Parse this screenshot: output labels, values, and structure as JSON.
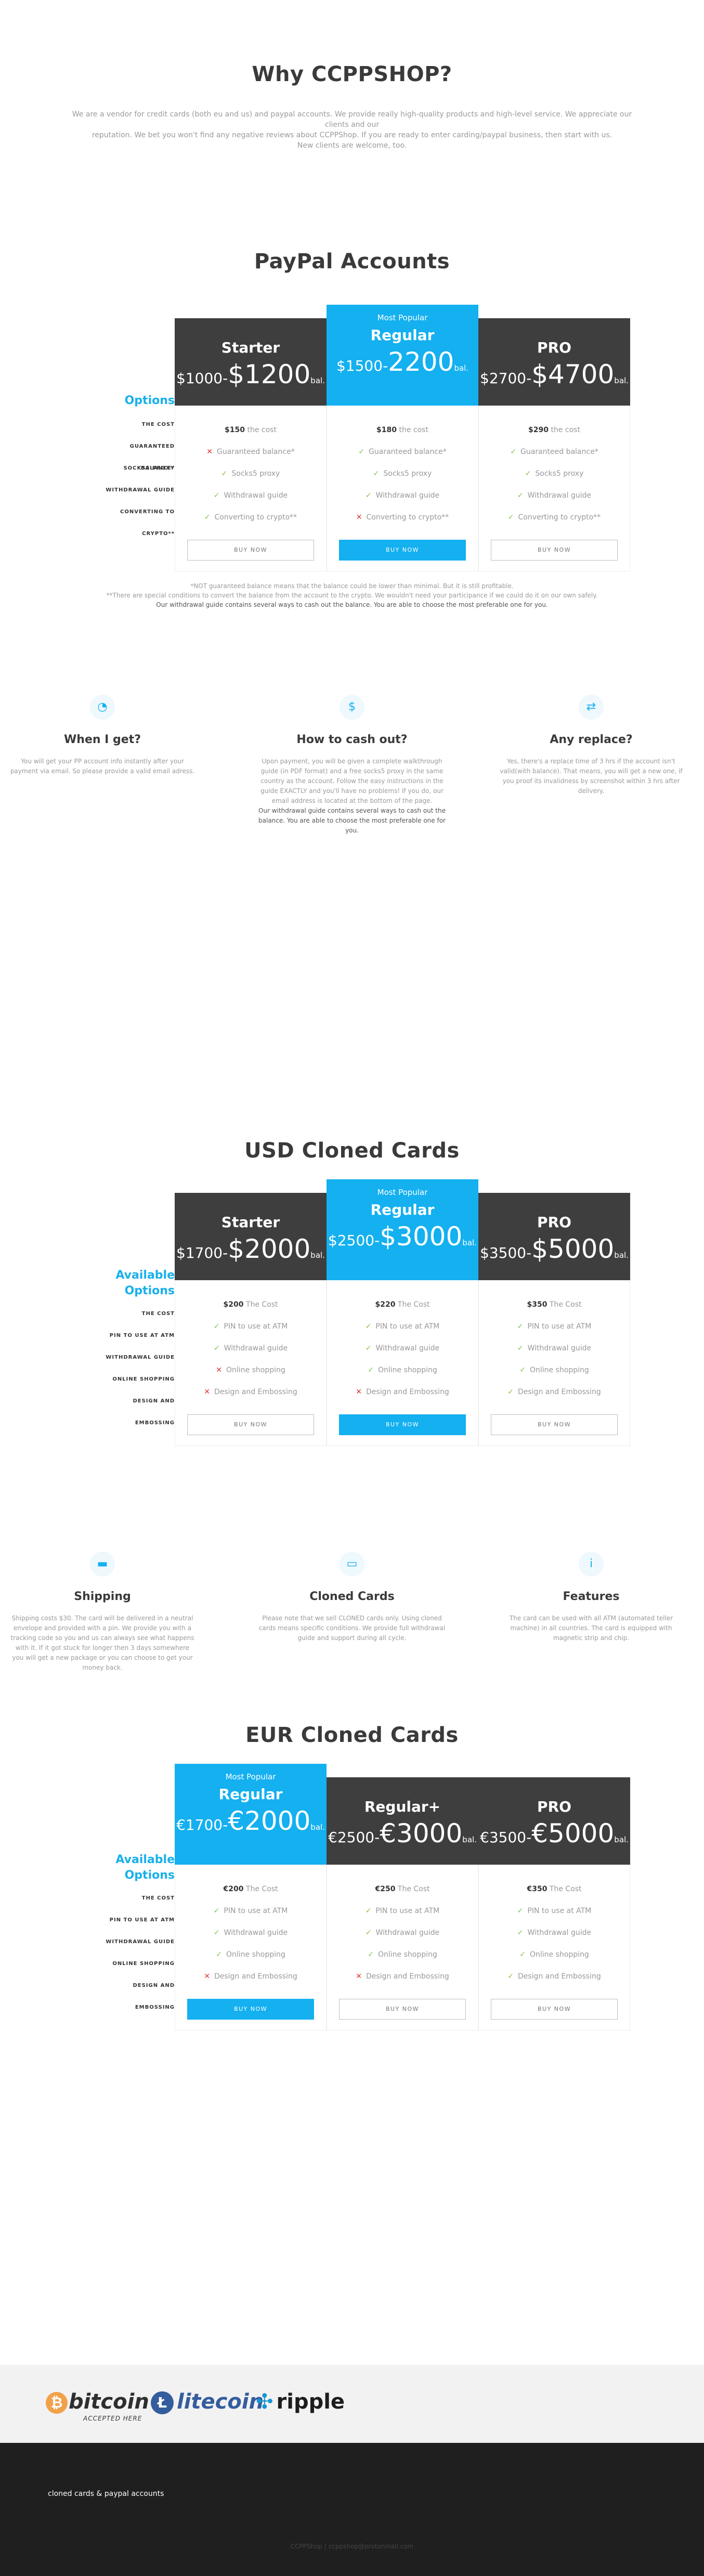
{
  "why": {
    "title": "Why CCPPSHOP?",
    "line1": "We are a vendor for credit cards (both eu and us) and paypal accounts. We provide really high-quality products and high-level service. We appreciate our clients and our",
    "line2": "reputation. We bet you won't find any negative reviews about CCPPShop. If you are ready to enter carding/paypal business, then start with us.",
    "line3": "New clients are welcome, too."
  },
  "paypal": {
    "title": "PayPal Accounts",
    "options_label": "Options",
    "row_labels": [
      "The cost",
      "Guaranteed balance*",
      "Socks5 proxy",
      "Withdrawal guide",
      "Converting to crypto**"
    ],
    "cols": [
      {
        "name": "Starter",
        "tag": "",
        "from": "$1000-",
        "to": "$1200",
        "ful": "bal.",
        "cost": "$150",
        "cost_label": "the cost",
        "features": [
          {
            "text": "Guaranteed balance*",
            "ok": false
          },
          {
            "text": "Socks5 proxy",
            "ok": true
          },
          {
            "text": "Withdrawal guide",
            "ok": true
          },
          {
            "text": "Converting to crypto**",
            "ok": true
          }
        ],
        "button": "Buy now"
      },
      {
        "name": "Regular",
        "tag": "Most Popular",
        "from": "$1500-",
        "to": "2200",
        "ful": "bal.",
        "cost": "$180",
        "cost_label": "the cost",
        "features": [
          {
            "text": "Guaranteed balance*",
            "ok": true
          },
          {
            "text": "Socks5 proxy",
            "ok": true
          },
          {
            "text": "Withdrawal guide",
            "ok": true
          },
          {
            "text": "Converting to crypto**",
            "ok": false
          }
        ],
        "button": "Buy now"
      },
      {
        "name": "PRO",
        "tag": "",
        "from": "$2700-",
        "to": "$4700",
        "ful": "bal.",
        "cost": "$290",
        "cost_label": "the cost",
        "features": [
          {
            "text": "Guaranteed balance*",
            "ok": true
          },
          {
            "text": "Socks5 proxy",
            "ok": true
          },
          {
            "text": "Withdrawal guide",
            "ok": true
          },
          {
            "text": "Converting to crypto**",
            "ok": true
          }
        ],
        "button": "Buy now"
      }
    ],
    "note1": "*NOT guaranteed balance means that the balance could be lower than minimal. But it is still profitable.",
    "note2": "**There are special conditions to convert the balance from the account to the crypto. We wouldn't need your participance if we could do it on our own safely.",
    "note3": "Our withdrawal guide contains several ways to cash out the balance. You are able to choose the most preferable one for you."
  },
  "info": [
    {
      "icon": "clock-icon",
      "glyph": "◔",
      "title": "When I get?",
      "text": "You will get your PP account info instantly after your payment via email. So please provide a valid email adress.",
      "strong": ""
    },
    {
      "icon": "dollar-icon",
      "glyph": "$",
      "title": "How to cash out?",
      "text": "Upon payment, you will be given a complete walkthrough guide (in PDF format) and a free socks5 proxy in the same country as the account. Follow the easy instructions in the guide EXACTLY and you'll have no problems! If you do, our email address is located at the bottom of the page.",
      "strong": "Our withdrawal guide contains several ways to cash out the balance. You are able to choose the most preferable one for you."
    },
    {
      "icon": "replace-icon",
      "glyph": "⇄",
      "title": "Any replace?",
      "text": "Yes, there's a replace time of 3 hrs if the account isn't valid(with balance). That means, you will get a new one, if you proof its invalidness by screenshot within 3 hrs after delivery.",
      "strong": ""
    }
  ],
  "usd": {
    "title": "USD Cloned Cards",
    "options_label": "Available Options",
    "row_labels": [
      "The cost",
      "PIN to use at ATM",
      "Withdrawal guide",
      "Online shopping",
      "Design and embossing"
    ],
    "cols": [
      {
        "name": "Starter",
        "tag": "",
        "from": "$1700-",
        "to": "$2000",
        "ful": "bal.",
        "cost": "$200",
        "cost_label": "The Cost",
        "features": [
          {
            "text": "PIN to use at ATM",
            "ok": true
          },
          {
            "text": "Withdrawal guide",
            "ok": true
          },
          {
            "text": "Online shopping",
            "ok": false
          },
          {
            "text": "Design and Embossing",
            "ok": false
          }
        ],
        "button": "Buy now"
      },
      {
        "name": "Regular",
        "tag": "Most Popular",
        "from": "$2500-",
        "to": "$3000",
        "ful": "bal.",
        "cost": "$220",
        "cost_label": "The Cost",
        "features": [
          {
            "text": "PIN to use at ATM",
            "ok": true
          },
          {
            "text": "Withdrawal guide",
            "ok": true
          },
          {
            "text": "Online shopping",
            "ok": true
          },
          {
            "text": "Design and Embossing",
            "ok": false
          }
        ],
        "button": "Buy now"
      },
      {
        "name": "PRO",
        "tag": "",
        "from": "$3500-",
        "to": "$5000",
        "ful": "bal.",
        "cost": "$350",
        "cost_label": "The Cost",
        "features": [
          {
            "text": "PIN to use at ATM",
            "ok": true
          },
          {
            "text": "Withdrawal guide",
            "ok": true
          },
          {
            "text": "Online shopping",
            "ok": true
          },
          {
            "text": "Design and Embossing",
            "ok": true
          }
        ],
        "button": "Buy now"
      }
    ]
  },
  "cards_info": [
    {
      "icon": "truck-icon",
      "glyph": "▬",
      "title": "Shipping",
      "text": "Shipping costs $30. The card will be delivered in a neutral envelope and provided with a pin. We provide you with a tracking code so you and us can always see what happens with it. If it got stuck for longer then 3 days somewhere you will get a new package or you can choose to get your money back."
    },
    {
      "icon": "card-icon",
      "glyph": "▭",
      "title": "Cloned Cards",
      "text": "Please note that we sell CLONED cards only. Using cloned cards means specific conditions. We provide full withdrawal guide and support during all cycle."
    },
    {
      "icon": "info-icon",
      "glyph": "i",
      "title": "Features",
      "text": "The card can be used with all ATM (automated teller machine) in all countries. The card is equipped with magnetic strip and chip."
    }
  ],
  "eur": {
    "title": "EUR Cloned Cards",
    "options_label": "Available Options",
    "row_labels": [
      "The cost",
      "PIN to use at ATM",
      "Withdrawal guide",
      "Online shopping",
      "Design and embossing"
    ],
    "cols": [
      {
        "name": "Regular",
        "tag": "Most Popular",
        "from": "€1700-",
        "to": "€2000",
        "ful": "bal.",
        "cost": "€200",
        "cost_label": "The Cost",
        "features": [
          {
            "text": "PIN to use at ATM",
            "ok": true
          },
          {
            "text": "Withdrawal guide",
            "ok": true
          },
          {
            "text": "Online shopping",
            "ok": true
          },
          {
            "text": "Design and Embossing",
            "ok": false
          }
        ],
        "button": "Buy now"
      },
      {
        "name": "Regular+",
        "tag": "",
        "from": "€2500-",
        "to": "€3000",
        "ful": "bal.",
        "cost": "€250",
        "cost_label": "The Cost",
        "features": [
          {
            "text": "PIN to use at ATM",
            "ok": true
          },
          {
            "text": "Withdrawal guide",
            "ok": true
          },
          {
            "text": "Online shopping",
            "ok": true
          },
          {
            "text": "Design and Embossing",
            "ok": false
          }
        ],
        "button": "Buy now"
      },
      {
        "name": "PRO",
        "tag": "",
        "from": "€3500-",
        "to": "€5000",
        "ful": "bal.",
        "cost": "€350",
        "cost_label": "The Cost",
        "features": [
          {
            "text": "PIN to use at ATM",
            "ok": true
          },
          {
            "text": "Withdrawal guide",
            "ok": true
          },
          {
            "text": "Online shopping",
            "ok": true
          },
          {
            "text": "Design and Embossing",
            "ok": true
          }
        ],
        "button": "Buy now"
      }
    ]
  },
  "crypto": {
    "bitcoin": "bitcoin",
    "bitcoin_sub": "ACCEPTED HERE",
    "litecoin": "litecoin",
    "ripple": "ripple"
  },
  "footer": {
    "text": "cloned cards & paypal accounts",
    "copyright": "CCPPShop | ccppshop@protonmail.com"
  },
  "colors": {
    "accent": "#14b0f0",
    "dark": "#3e3e3e",
    "ok": "#7fc241",
    "no": "#e0312f"
  }
}
